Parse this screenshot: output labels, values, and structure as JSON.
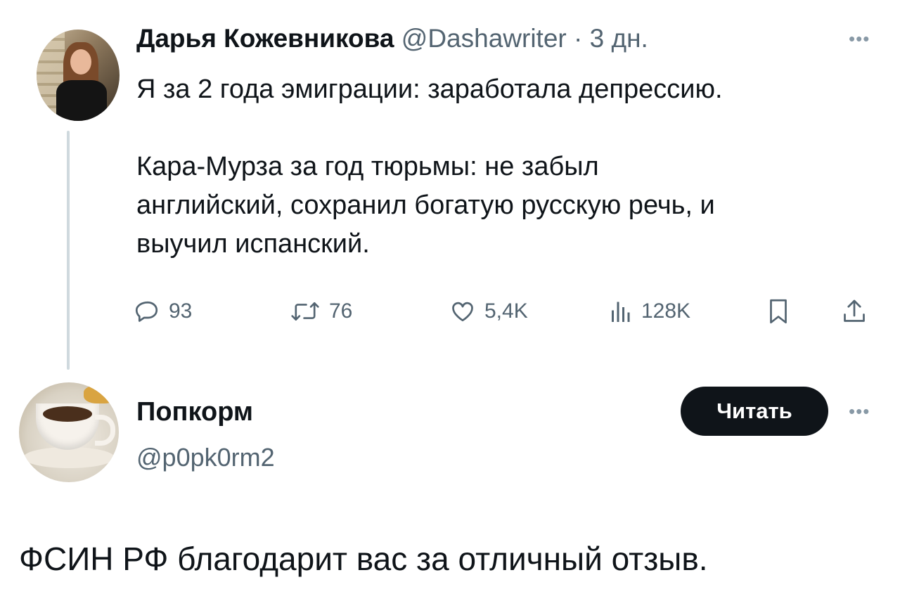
{
  "tweet": {
    "display_name": "Дарья Кожевникова",
    "handle": "@Dashawriter",
    "separator": " · ",
    "time": "3 дн.",
    "text": "Я за 2 года эмиграции: заработала депрессию.\n\nКара-Мурза за год тюрьмы: не забыл\nанглийский, сохранил богатую русскую речь, и\nвыучил испанский.",
    "actions": {
      "replies": "93",
      "retweets": "76",
      "likes": "5,4K",
      "views": "128K"
    }
  },
  "reply": {
    "display_name": "Попкорм",
    "handle": "@p0pk0rm2",
    "follow_label": "Читать",
    "text": "ФСИН РФ благодарит вас за отличный отзыв."
  },
  "icons": {
    "more": "more-dots-icon",
    "reply": "speech-bubble-icon",
    "retweet": "retweet-arrows-icon",
    "like": "heart-icon",
    "views": "bar-chart-icon",
    "bookmark": "bookmark-icon",
    "share": "share-upload-icon"
  },
  "colors": {
    "text": "#0f1419",
    "secondary": "#536471",
    "follow_button_bg": "#0f1419",
    "thread_line": "#cfd9de"
  }
}
